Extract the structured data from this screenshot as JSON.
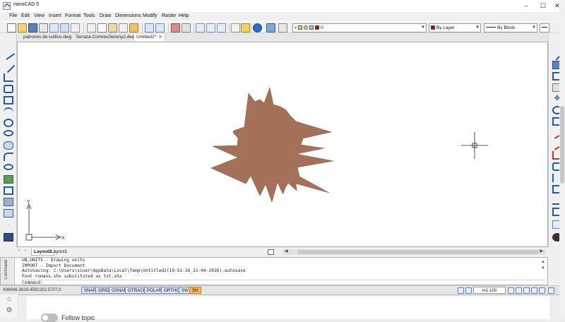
{
  "window": {
    "title": "nanoCAD 5",
    "controls": {
      "minimize": "–",
      "maximize": "☐",
      "close": "✕"
    }
  },
  "menu": [
    "File",
    "Edit",
    "View",
    "Insert",
    "Format",
    "Tools",
    "Draw",
    "Dimensions",
    "Modify",
    "Raster",
    "Help"
  ],
  "toolbar": {
    "layer_value": "0",
    "color_value": "By Layer",
    "linetype_value": "By Block"
  },
  "tabs": [
    {
      "label": "patrones de cultivo.dwg",
      "active": false
    },
    {
      "label": "Terraza ComreuSereny2.dwg*",
      "active": false
    },
    {
      "label": "Untitled2*",
      "active": true
    }
  ],
  "canvas": {
    "shape_color": "#a47058",
    "ucs_x_label": "X",
    "ucs_y_label": "Y"
  },
  "layout_tabs": [
    {
      "label": "Layout2",
      "active": true
    },
    {
      "label": "Layout1",
      "active": false
    }
  ],
  "command": {
    "side_label": "Command",
    "lines": [
      "UN,UNITS - Drawing units",
      "IMPORT - Import Document",
      "AutoSaving: C:\\Users\\siner\\AppData\\Local\\Temp\\Untitled2(19-51-26_21-04-2026).autosave",
      "Font romans.shx substituted as txt.shx"
    ],
    "prompt": "Command:"
  },
  "status": {
    "coords": "436646.3628,4591202.5707,0",
    "buttons": [
      {
        "label": "SNAP",
        "state": "on"
      },
      {
        "label": "GRID",
        "state": "on"
      },
      {
        "label": "OSNAP",
        "state": "on"
      },
      {
        "label": "OTRACK",
        "state": "on"
      },
      {
        "label": "POLAR",
        "state": "on"
      },
      {
        "label": "ORTHO",
        "state": "on"
      },
      {
        "label": "SW",
        "state": "on"
      },
      {
        "label": "SH",
        "state": "highlight"
      }
    ],
    "scale": "m1:100"
  },
  "page": {
    "follow_label": "Follow topic"
  }
}
